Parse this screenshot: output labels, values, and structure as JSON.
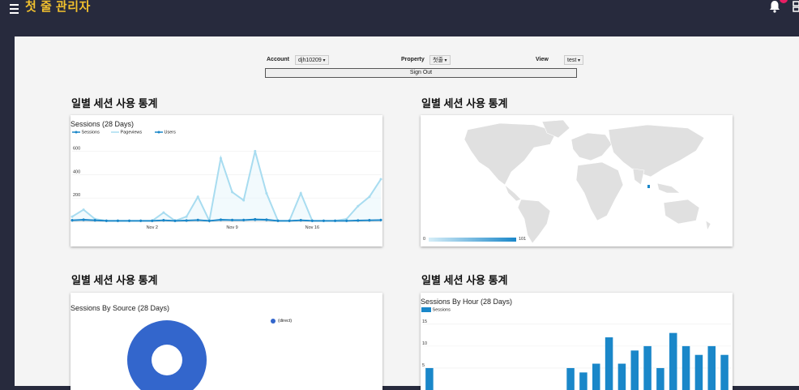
{
  "header": {
    "title": "첫 줄 관리자",
    "menu_icon": "hamburger-icon",
    "notification_icon": "bell-icon",
    "apps_icon": "grid-icon"
  },
  "controls": {
    "account_label": "Account",
    "account_value": "djh10209",
    "property_label": "Property",
    "property_value": "첫줄",
    "view_label": "View",
    "view_value": "test",
    "signout_label": "Sign Out"
  },
  "sections": [
    {
      "title": "일별 세션 사용 통계"
    },
    {
      "title": "일별 세션 사용 통계"
    },
    {
      "title": "일별 세션 사용 통계"
    },
    {
      "title": "일별 세션 사용 통계"
    }
  ],
  "chart_data": [
    {
      "type": "line",
      "title": "Sessions (28 Days)",
      "legend": [
        "Sessions",
        "Pageviews",
        "Users"
      ],
      "colors": {
        "Sessions": "#1a87c9",
        "Pageviews": "#a8dcf0",
        "Users": "#1a87c9"
      },
      "x_ticks": [
        "Nov 2",
        "Nov 9",
        "Nov 16"
      ],
      "ylim": [
        0,
        700
      ],
      "yticks": [
        200,
        400,
        600
      ],
      "series": [
        {
          "name": "Pageviews",
          "values": [
            40,
            100,
            20,
            5,
            5,
            5,
            5,
            5,
            75,
            5,
            40,
            210,
            5,
            540,
            250,
            180,
            600,
            240,
            5,
            5,
            240,
            5,
            5,
            5,
            20,
            130,
            210,
            360
          ]
        },
        {
          "name": "Sessions",
          "values": [
            10,
            15,
            10,
            5,
            5,
            5,
            5,
            5,
            10,
            5,
            8,
            12,
            5,
            15,
            12,
            12,
            18,
            15,
            5,
            5,
            10,
            5,
            5,
            5,
            5,
            8,
            10,
            12
          ]
        },
        {
          "name": "Users",
          "values": [
            8,
            12,
            8,
            4,
            4,
            4,
            4,
            4,
            8,
            4,
            6,
            10,
            4,
            12,
            10,
            10,
            14,
            12,
            4,
            4,
            8,
            4,
            4,
            4,
            4,
            6,
            8,
            10
          ]
        }
      ]
    },
    {
      "type": "heatmap",
      "title": "",
      "scale_min": "0",
      "scale_max": "101",
      "colors": {
        "land": "#e0e0e0",
        "highlight": "#1a87c9",
        "scale_low": "#d6eef8",
        "scale_high": "#1a87c9"
      }
    },
    {
      "type": "pie",
      "title": "Sessions By Source (28 Days)",
      "slices": [
        {
          "name": "(direct)",
          "value": 100
        }
      ],
      "colors": {
        "(direct)": "#3366cc"
      }
    },
    {
      "type": "bar",
      "title": "Sessions By Hour (28 Days)",
      "legend": [
        "Sessions"
      ],
      "color": "#1a87c9",
      "ylim": [
        0,
        17
      ],
      "yticks": [
        5,
        10,
        15
      ],
      "values": [
        5,
        0,
        0,
        0,
        0,
        0,
        0,
        0,
        0,
        0,
        0,
        5,
        4,
        6,
        12,
        6,
        9,
        10,
        5,
        13,
        10,
        8,
        10,
        8
      ]
    }
  ]
}
